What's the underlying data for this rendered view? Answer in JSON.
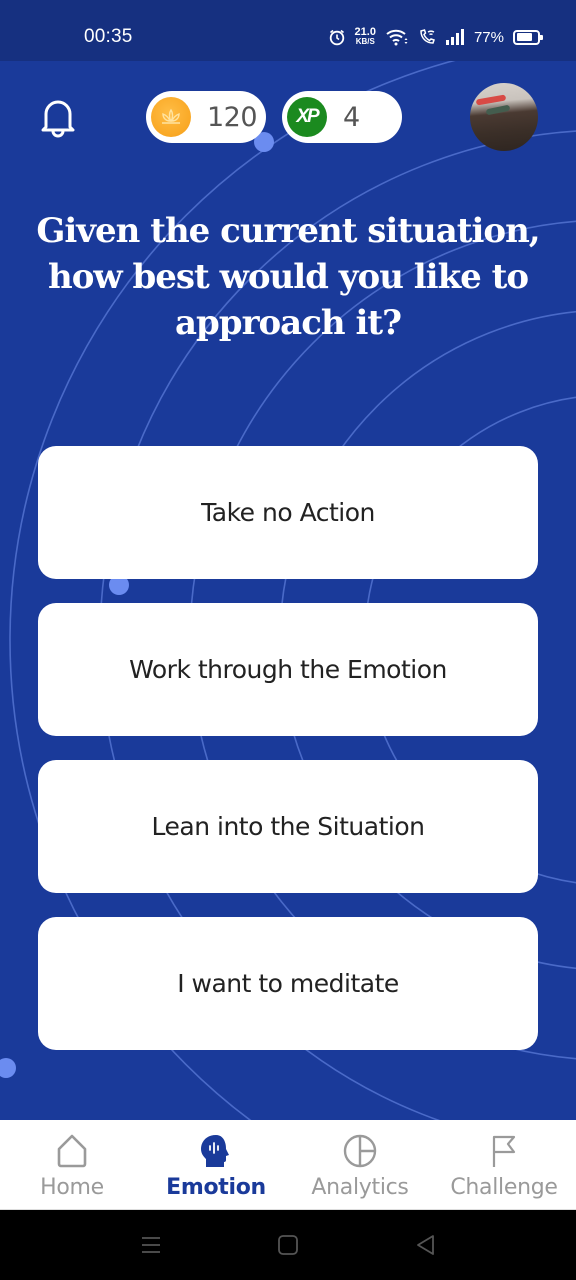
{
  "status_bar": {
    "time": "00:35",
    "net_speed_value": "21.0",
    "net_speed_unit": "KB/S",
    "battery_percent": "77%",
    "battery_level": 0.77,
    "icons": [
      "alarm-icon",
      "wifi-icon",
      "wifi-calling-icon",
      "signal-icon",
      "battery-icon"
    ]
  },
  "header": {
    "notification_icon": "bell-icon",
    "coins": {
      "icon": "coin-icon",
      "value": "120"
    },
    "xp": {
      "icon": "xp-icon",
      "icon_text": "XP",
      "value": "4"
    },
    "avatar": "profile-avatar"
  },
  "question": {
    "text": "Given the current situation, how best would you like to approach it?"
  },
  "options": [
    {
      "label": "Take no Action"
    },
    {
      "label": "Work through the Emotion"
    },
    {
      "label": "Lean into the Situation"
    },
    {
      "label": "I want to meditate"
    }
  ],
  "bottom_nav": {
    "active": "Emotion",
    "items": [
      {
        "label": "Home",
        "icon": "home-icon"
      },
      {
        "label": "Emotion",
        "icon": "emotion-head-icon"
      },
      {
        "label": "Analytics",
        "icon": "analytics-pie-icon"
      },
      {
        "label": "Challenge",
        "icon": "flag-icon"
      }
    ]
  },
  "system_nav": {
    "buttons": [
      "recents-button",
      "home-button",
      "back-button"
    ]
  },
  "colors": {
    "primary": "#1a3a9a",
    "status_bar": "#163080",
    "accent_dot": "#6b8cf0",
    "coin": "#f9a825",
    "xp": "#1b8a1f",
    "inactive": "#9a9a9a"
  }
}
